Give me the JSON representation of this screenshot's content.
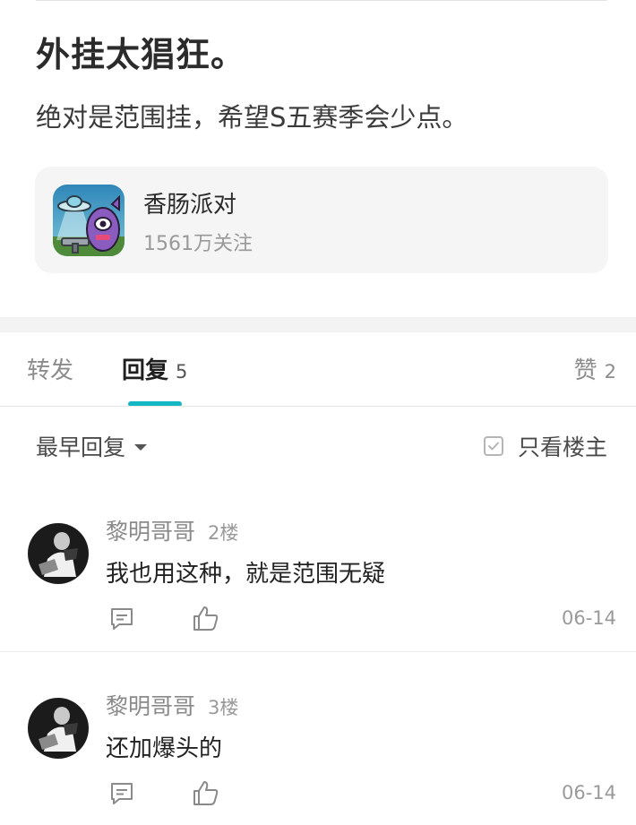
{
  "post": {
    "title": "外挂太猖狂。",
    "body": "绝对是范围挂，希望S五赛季会少点。"
  },
  "game": {
    "name": "香肠派对",
    "followers": "1561万关注"
  },
  "tabs": {
    "repost": "转发",
    "reply": "回复",
    "reply_count": "5",
    "like": "赞",
    "like_count": "2",
    "active": "回复",
    "indicator_color": "#14b8c4"
  },
  "filter": {
    "sort": "最早回复",
    "only_op": "只看楼主",
    "only_op_checked": false
  },
  "replies": [
    {
      "user": "黎明哥哥",
      "floor": "2楼",
      "text": "我也用这种，就是范围无疑",
      "date": "06-14"
    },
    {
      "user": "黎明哥哥",
      "floor": "3楼",
      "text": "还加爆头的",
      "date": "06-14"
    }
  ]
}
